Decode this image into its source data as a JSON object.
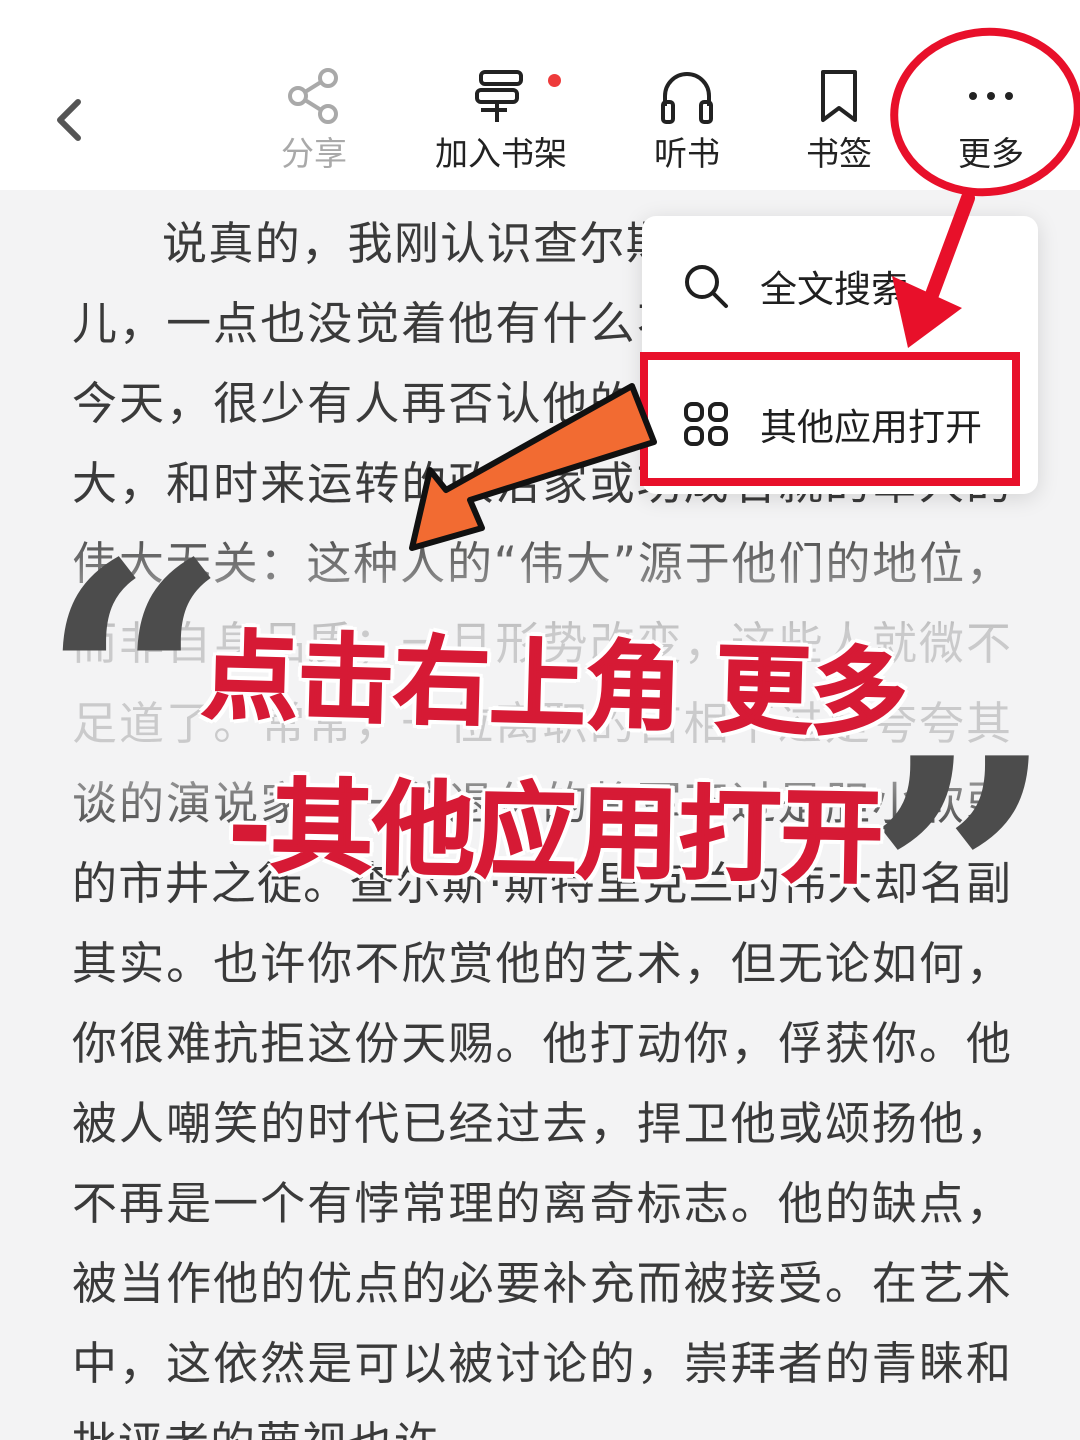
{
  "toolbar": {
    "back_icon": "chevron-left-icon",
    "items": [
      {
        "label": "分享",
        "icon": "share-icon",
        "enabled": false
      },
      {
        "label": "加入书架",
        "icon": "bookshelf-add-icon",
        "badge": true
      },
      {
        "label": "听书",
        "icon": "headphones-icon"
      },
      {
        "label": "书签",
        "icon": "bookmark-icon"
      },
      {
        "label": "更多",
        "icon": "more-dots-icon"
      }
    ]
  },
  "menu": {
    "items": [
      {
        "label": "全文搜索",
        "icon": "search-icon"
      },
      {
        "label": "其他应用打开",
        "icon": "apps-grid-icon"
      }
    ]
  },
  "reader": {
    "text": "说真的，我刚认识查尔斯·斯特里克兰那会儿，一点也没觉着他有什么不同凡响。可到了今天，很少有人再否认他的伟大了。我说的伟大，和时来运转的政治家或功成名就的军人的伟大无关：这种人的“伟大”源于他们的地位，而非自身品质；一旦形势改变，这些人就微不足道了。常常，一位离职的首相不过是夸夸其谈的演说家，一位退休的将军不过是胆小软弱的市井之徒。查尔斯·斯特里克兰的伟大却名副其实。也许你不欣赏他的艺术，但无论如何，你很难抗拒这份天赐。他打动你，俘获你。他被人嘲笑的时代已经过去，捍卫他或颂扬他，不再是一个有悖常理的离奇标志。他的缺点，被当作他的优点的必要补充而被接受。在艺术中，这依然是可以被讨论的，崇拜者的青睐和批评者的蔑视也许"
  },
  "annotation": {
    "line1": "点击右上角 更多",
    "line2": "-其他应用打开",
    "quote_open": "“",
    "quote_close": "”",
    "accent_color": "#d61a35",
    "arrow_colors": [
      "#e8102a",
      "#f26b32"
    ]
  }
}
